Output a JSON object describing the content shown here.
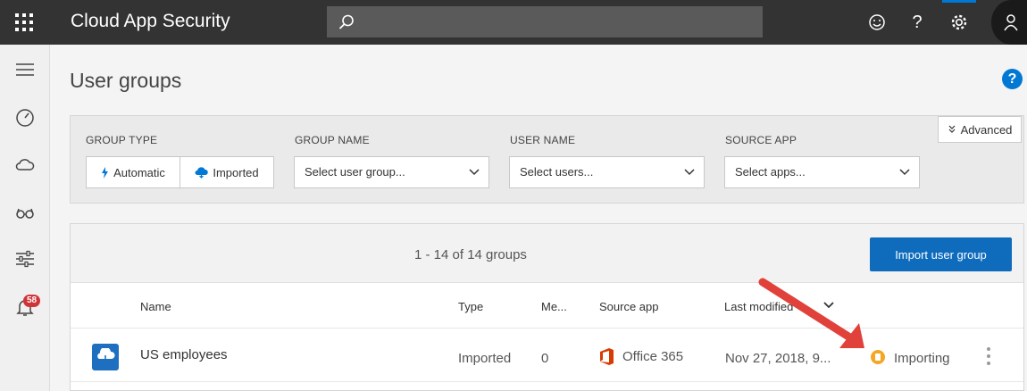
{
  "header": {
    "app_title": "Cloud App Security",
    "icons": [
      "apps-waffle-icon",
      "search-icon",
      "smiley-icon",
      "help-icon",
      "gear-icon",
      "user-icon"
    ],
    "help_glyph": "?",
    "accent": "#0078d4"
  },
  "sidebar": {
    "items": [
      "hamburger-menu-icon",
      "dashboard-gauge-icon",
      "cloud-icon",
      "glasses-icon",
      "sliders-icon",
      "bell-icon"
    ],
    "alerts_badge": "58"
  },
  "page": {
    "title": "User groups",
    "help": "?"
  },
  "filters": {
    "advanced_label": "Advanced",
    "group_type": {
      "label": "GROUP TYPE",
      "options": [
        "Automatic",
        "Imported"
      ]
    },
    "group_name": {
      "label": "GROUP NAME",
      "placeholder": "Select user group..."
    },
    "user_name": {
      "label": "USER NAME",
      "placeholder": "Select users..."
    },
    "source_app": {
      "label": "SOURCE APP",
      "placeholder": "Select apps..."
    }
  },
  "table": {
    "count_text": "1 - 14 of 14 groups",
    "import_button": "Import user group",
    "columns": [
      "Name",
      "Type",
      "Me...",
      "Source app",
      "Last modified"
    ],
    "rows": [
      {
        "name": "US employees",
        "type": "Imported",
        "members": "0",
        "source_app": "Office 365",
        "last_modified": "Nov 27, 2018, 9...",
        "status": "Importing"
      }
    ]
  },
  "colors": {
    "topbar": "#333333",
    "primary_button": "#0f6cbd",
    "status_importing": "#f5a623",
    "annotation_arrow": "#e0413a",
    "office_red": "#d83b01"
  }
}
